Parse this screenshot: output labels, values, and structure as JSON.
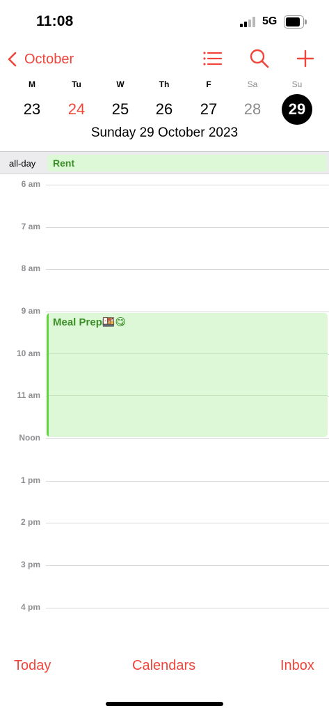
{
  "status_bar": {
    "time": "11:08",
    "network": "5G"
  },
  "nav": {
    "back_label": "October"
  },
  "week": {
    "days": [
      {
        "weekday": "M",
        "date": "23"
      },
      {
        "weekday": "Tu",
        "date": "24"
      },
      {
        "weekday": "W",
        "date": "25"
      },
      {
        "weekday": "Th",
        "date": "26"
      },
      {
        "weekday": "F",
        "date": "27"
      },
      {
        "weekday": "Sa",
        "date": "28"
      },
      {
        "weekday": "Su",
        "date": "29"
      }
    ],
    "selected_title": "Sunday  29 October 2023"
  },
  "all_day": {
    "label": "all-day",
    "event": "Rent"
  },
  "timeline": {
    "hours": [
      "6 am",
      "7 am",
      "8 am",
      "9 am",
      "10 am",
      "11 am",
      "Noon",
      "1 pm",
      "2 pm",
      "3 pm",
      "4 pm"
    ],
    "event": {
      "title": "Meal Prep🍱😋",
      "start": "9 am",
      "end": "Noon"
    }
  },
  "toolbar": {
    "today": "Today",
    "calendars": "Calendars",
    "inbox": "Inbox"
  },
  "colors": {
    "accent": "#f0453a",
    "event_fill": "#dcf8d6",
    "event_text": "#3c8f28",
    "event_bar": "#5fd63d"
  }
}
